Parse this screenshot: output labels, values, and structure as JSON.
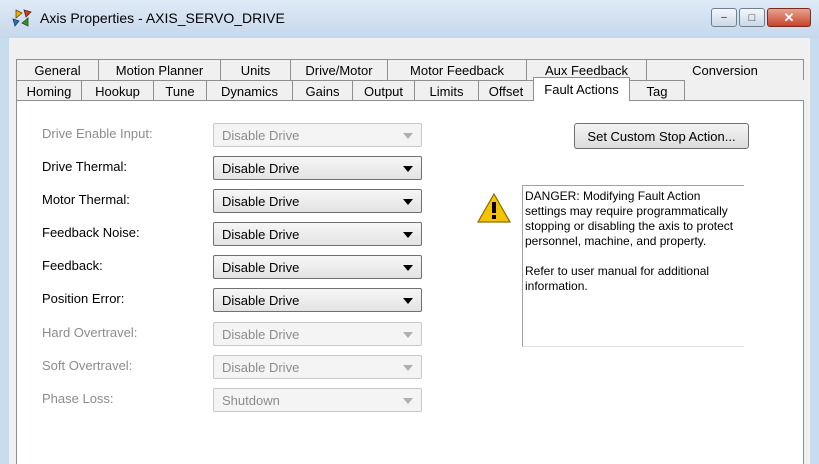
{
  "window": {
    "title": "Axis Properties - AXIS_SERVO_DRIVE",
    "minimize_glyph": "−",
    "maximize_glyph": "□",
    "close_glyph": "✕"
  },
  "tabs": {
    "back_row": [
      "General",
      "Motion Planner",
      "Units",
      "Drive/Motor",
      "Motor Feedback",
      "Aux Feedback",
      "Conversion"
    ],
    "front_row": [
      "Homing",
      "Hookup",
      "Tune",
      "Dynamics",
      "Gains",
      "Output",
      "Limits",
      "Offset",
      "Fault Actions",
      "Tag"
    ],
    "active": "Fault Actions"
  },
  "fields": [
    {
      "label": "Drive Enable Input:",
      "value": "Disable Drive",
      "enabled": false
    },
    {
      "label": "Drive Thermal:",
      "value": "Disable Drive",
      "enabled": true
    },
    {
      "label": "Motor Thermal:",
      "value": "Disable Drive",
      "enabled": true
    },
    {
      "label": "Feedback Noise:",
      "value": "Disable Drive",
      "enabled": true
    },
    {
      "label": "Feedback:",
      "value": "Disable Drive",
      "enabled": true
    },
    {
      "label": "Position Error:",
      "value": "Disable Drive",
      "enabled": true
    },
    {
      "label": "Hard Overtravel:",
      "value": "Disable Drive",
      "enabled": false
    },
    {
      "label": "Soft Overtravel:",
      "value": "Disable Drive",
      "enabled": false
    },
    {
      "label": "Phase Loss:",
      "value": "Shutdown",
      "enabled": false
    }
  ],
  "custom_stop_button": "Set Custom Stop Action...",
  "danger_text": "DANGER: Modifying Fault Action settings may require programmatically stopping or disabling the axis to protect personnel, machine, and property.\n\nRefer to user manual for additional information.",
  "icons": {
    "app": "axis-properties-icon",
    "warning": "warning-triangle-icon"
  },
  "colors": {
    "title_bar": "#c6d8ec",
    "close_button": "#c7432a",
    "warning_yellow": "#f5c400"
  }
}
